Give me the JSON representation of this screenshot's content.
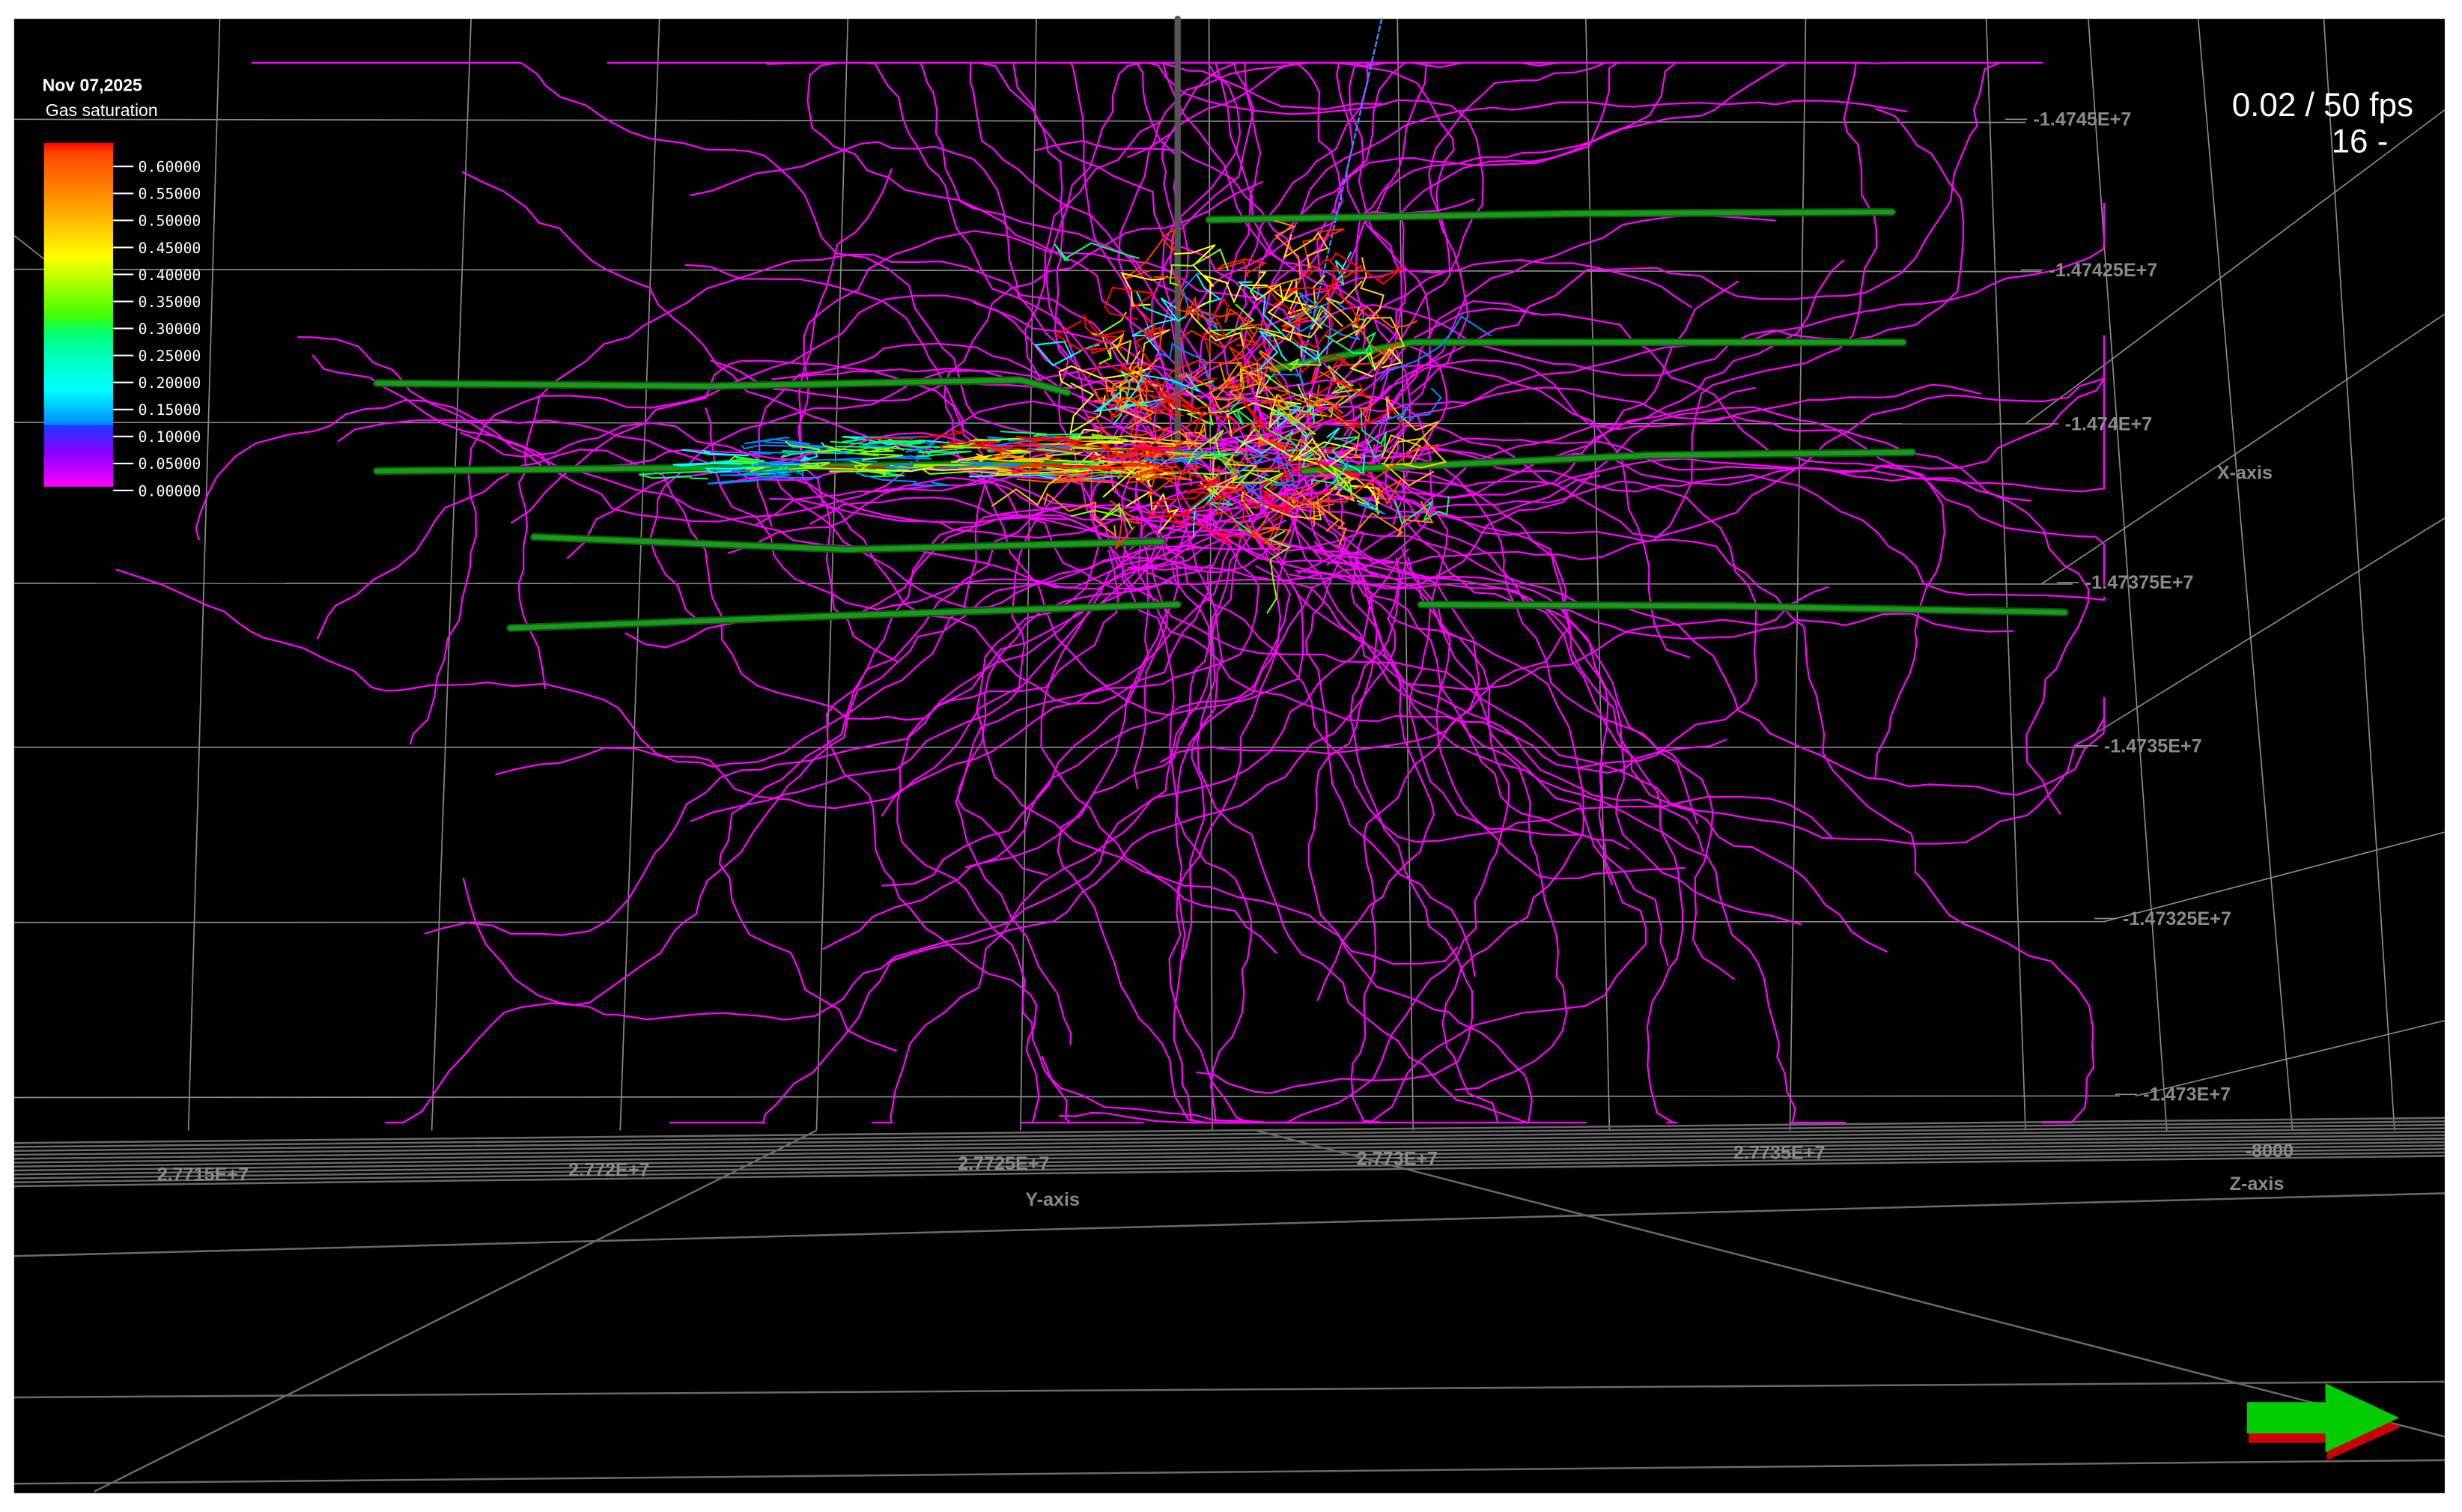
{
  "viewer": {
    "date": "Nov 07,2025",
    "property": "Gas saturation",
    "fps": "0.02 / 50 fps",
    "frame": "16 -"
  },
  "legend": {
    "ticks": [
      "0.60000",
      "0.55000",
      "0.50000",
      "0.45000",
      "0.40000",
      "0.35000",
      "0.30000",
      "0.25000",
      "0.20000",
      "0.15000",
      "0.10000",
      "0.05000",
      "0.00000"
    ],
    "colors": [
      "#ff0000",
      "#ff8800",
      "#ffff00",
      "#b0ff00",
      "#00ff00",
      "#00ffaa",
      "#00ffff",
      "#0088ff",
      "#0000ff",
      "#8800ff",
      "#ff00ff"
    ]
  },
  "axes": {
    "x_label": "X-axis",
    "x_ticks": [
      "-1.4745E+7",
      "-1.47425E+7",
      "-1.474E+7",
      "-1.47375E+7",
      "-1.4735E+7",
      "-1.47325E+7",
      "-1.473E+7"
    ],
    "y_label": "Y-axis",
    "y_ticks": [
      "2.7715E+7",
      "2.772E+7",
      "2.7725E+7",
      "2.773E+7",
      "2.7735E+7"
    ],
    "z_label": "Z-axis",
    "z_ticks": [
      "-8000"
    ]
  },
  "colors": {
    "background": "#000000",
    "grid": "#8a8a8a",
    "streamline": "#ff00ff",
    "well": "#1a9a1a",
    "arrow": "#00cc00"
  }
}
